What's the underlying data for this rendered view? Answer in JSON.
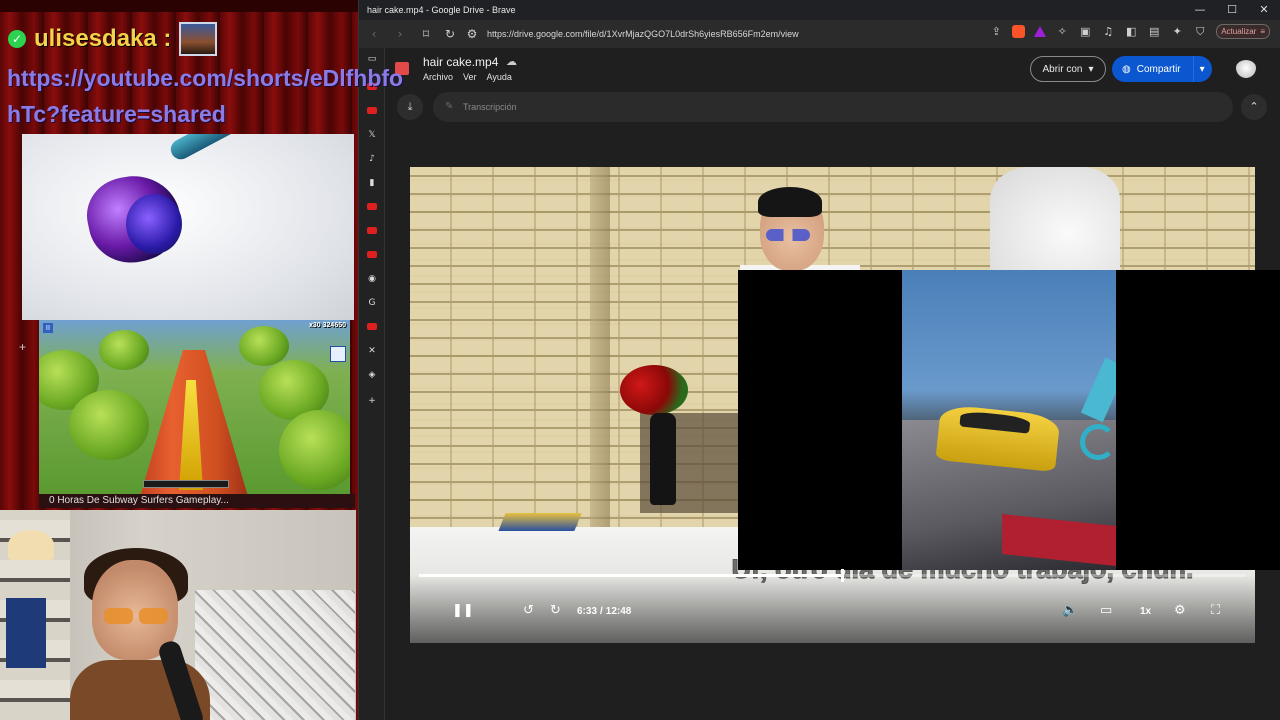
{
  "stream": {
    "chat_username": "ulisesdaka :",
    "chat_link": "https://youtube.com/shorts/eDlfhbfohTc?feature=shared",
    "game_score": "324650",
    "game_multiplier": "x30",
    "under_caption": "0 Horas De Subway Surfers Gameplay..."
  },
  "window": {
    "title": "hair cake.mp4 - Google Drive - Brave",
    "min_icon": "—",
    "max_icon": "☐",
    "close_icon": "✕"
  },
  "toolbar": {
    "url": "https://drive.google.com/file/d/1XvrMjazQGO7L0drSh6yiesRB656Fm2em/view",
    "update_label": "Actualizar"
  },
  "drive": {
    "file_title": "hair cake.mp4",
    "menu": [
      "Archivo",
      "Ver",
      "Ayuda"
    ],
    "open_with_label": "Abrir con",
    "share_label": "Compartir",
    "transcript_placeholder": "Transcripción"
  },
  "player": {
    "subtitle": "Uf, otro día de mucho trabajo, chun.",
    "current_time": "6:33",
    "separator": "/",
    "duration": "12:48",
    "speed": "1x",
    "progress_fraction": 0.512
  },
  "colors": {
    "share_blue": "#0b57d0",
    "chat_user_yellow": "#f2d34a",
    "chat_link_purple": "#8a7ce8",
    "youtube_red": "#e02020"
  },
  "icons": {
    "sidebar": [
      "youtube-icon",
      "youtube-icon",
      "x-icon",
      "tiktok-icon",
      "analytics-icon",
      "youtube-icon",
      "youtube-icon",
      "youtube-icon",
      "brave-news-icon",
      "google-icon",
      "youtube-icon",
      "close-icon",
      "brave-icon",
      "plus-icon"
    ]
  }
}
